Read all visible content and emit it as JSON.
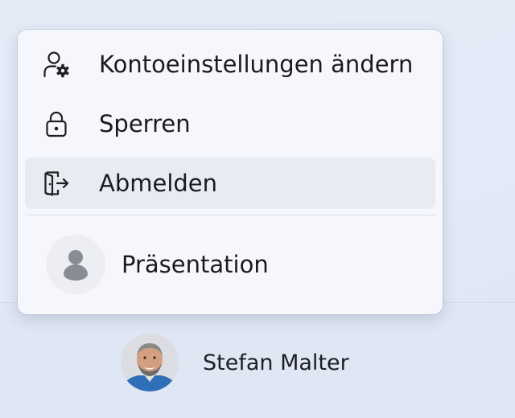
{
  "menu": {
    "items": [
      {
        "label": "Kontoeinstellungen ändern",
        "icon": "account-settings-icon",
        "hovered": false
      },
      {
        "label": "Sperren",
        "icon": "lock-icon",
        "hovered": false
      },
      {
        "label": "Abmelden",
        "icon": "sign-out-icon",
        "hovered": true
      }
    ],
    "other_account": {
      "label": "Präsentation",
      "icon": "person-icon"
    }
  },
  "current_user": {
    "name": "Stefan Malter",
    "avatar": "user-photo"
  },
  "colors": {
    "menu_background": "#f5f7fc",
    "hover_background": "#e8ebf2",
    "desktop_background": "#e3e9f6",
    "text": "#1b1b1f"
  }
}
